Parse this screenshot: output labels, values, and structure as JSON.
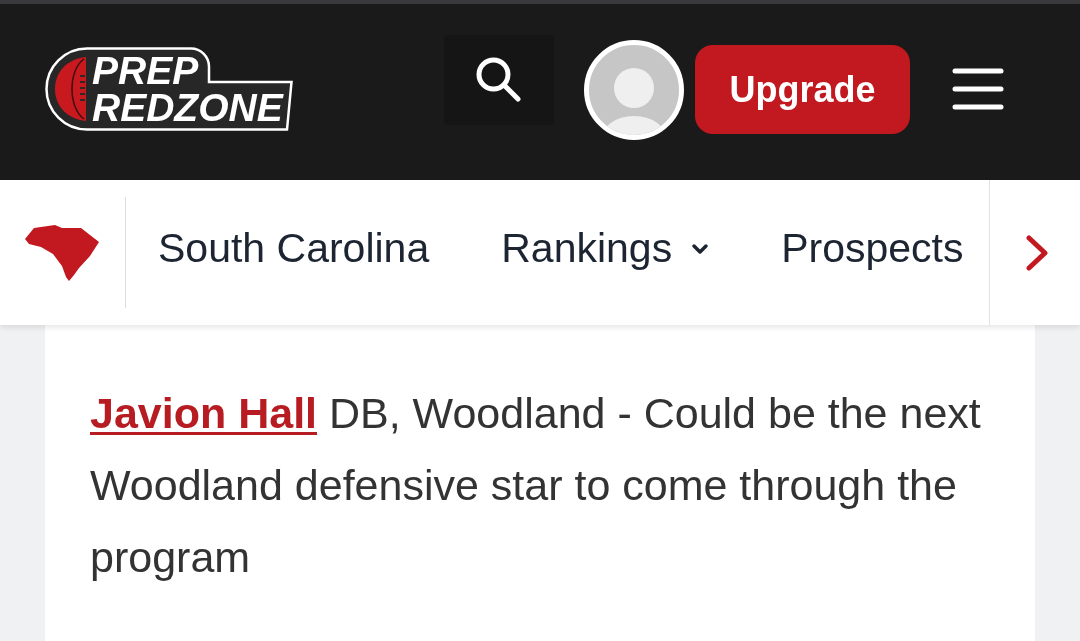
{
  "header": {
    "logo": {
      "lines": [
        "PREP",
        "REDZONE"
      ]
    },
    "upgrade_button": "Upgrade"
  },
  "nav": {
    "state": "South Carolina",
    "items": [
      {
        "label": "Rankings",
        "kind": "dropdown"
      },
      {
        "label": "Prospects",
        "kind": "link"
      }
    ]
  },
  "article": {
    "paragraphs": [
      {
        "player": "Javion Hall",
        "text": "DB, Woodland - Could be the next Woodland defensive star to come through the program"
      }
    ]
  }
}
